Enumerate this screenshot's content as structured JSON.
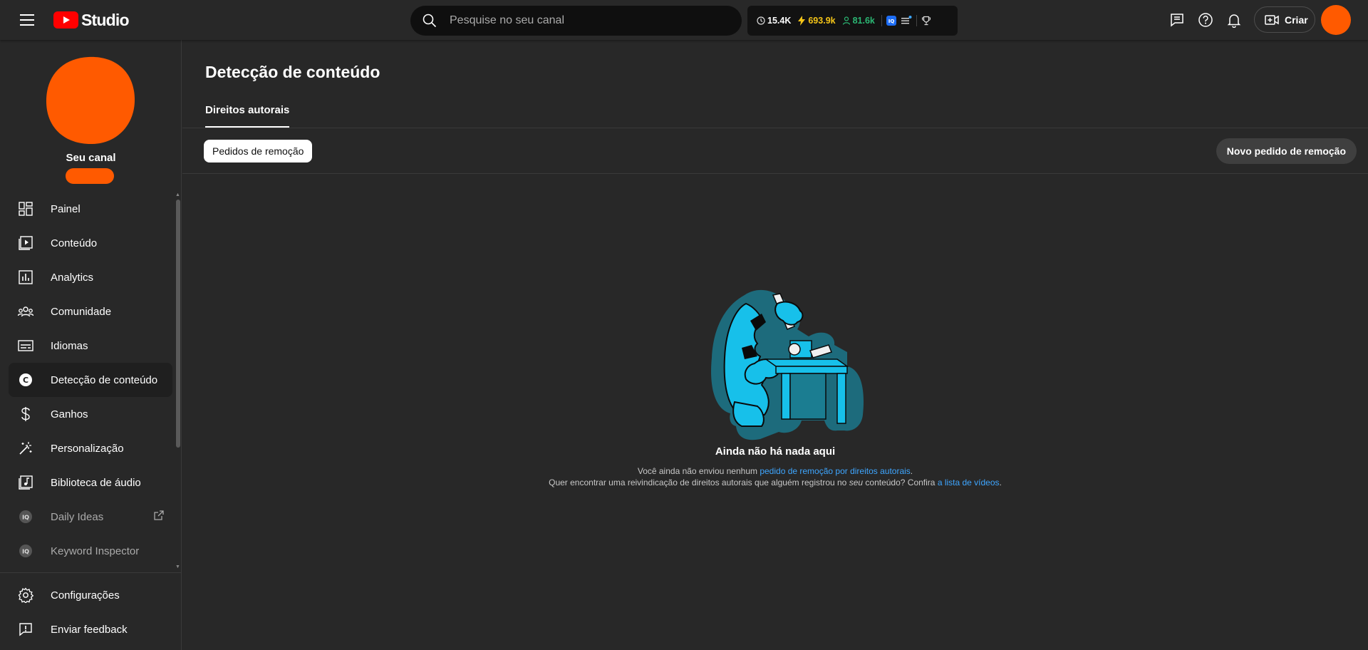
{
  "header": {
    "logo_text": "Studio",
    "search_placeholder": "Pesquise no seu canal",
    "stats": {
      "views": "15.4K",
      "bolt": "693.9k",
      "subscribers": "81.6k"
    },
    "create_label": "Criar"
  },
  "sidebar": {
    "channel_label": "Seu canal",
    "items": [
      {
        "label": "Painel",
        "icon": "dashboard-icon"
      },
      {
        "label": "Conteúdo",
        "icon": "content-icon"
      },
      {
        "label": "Analytics",
        "icon": "analytics-icon"
      },
      {
        "label": "Comunidade",
        "icon": "community-icon"
      },
      {
        "label": "Idiomas",
        "icon": "subtitles-icon"
      },
      {
        "label": "Detecção de conteúdo",
        "icon": "copyright-icon"
      },
      {
        "label": "Ganhos",
        "icon": "dollar-icon"
      },
      {
        "label": "Personalização",
        "icon": "magic-wand-icon"
      },
      {
        "label": "Biblioteca de áudio",
        "icon": "audio-library-icon"
      },
      {
        "label": "Daily Ideas",
        "icon": "vidiq-icon"
      },
      {
        "label": "Keyword Inspector",
        "icon": "vidiq-icon"
      }
    ],
    "bottom": [
      {
        "label": "Configurações",
        "icon": "gear-icon"
      },
      {
        "label": "Enviar feedback",
        "icon": "feedback-icon"
      }
    ]
  },
  "main": {
    "title": "Detecção de conteúdo",
    "tab": "Direitos autorais",
    "chip": "Pedidos de remoção",
    "new_request": "Novo pedido de remoção",
    "empty": {
      "title": "Ainda não há nada aqui",
      "line1_prefix": "Você ainda não enviou nenhum ",
      "line1_link": "pedido de remoção por direitos autorais",
      "line1_suffix": ".",
      "line2_prefix": "Quer encontrar uma reivindicação de direitos autorais que alguém registrou no ",
      "line2_em": "seu",
      "line2_mid": " conteúdo? Confira ",
      "line2_link": "a lista de vídeos",
      "line2_suffix": "."
    }
  },
  "colors": {
    "accent_orange": "#ff5a00",
    "link_blue": "#3ea6ff",
    "brand_red": "#ff0000",
    "illustration_cyan": "#1ec8f0"
  }
}
